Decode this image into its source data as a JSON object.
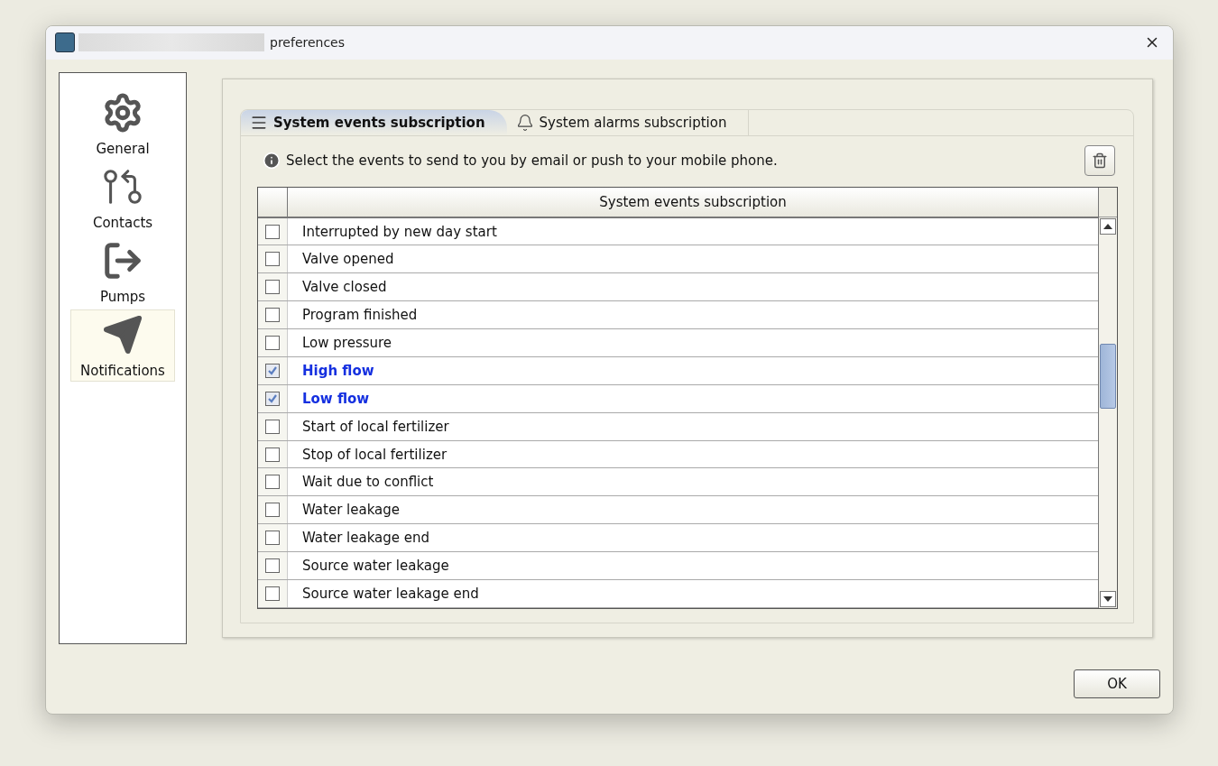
{
  "window": {
    "title": "preferences"
  },
  "sidebar": {
    "items": [
      {
        "label": "General",
        "selected": false
      },
      {
        "label": "Contacts",
        "selected": false
      },
      {
        "label": "Pumps",
        "selected": false
      },
      {
        "label": "Notifications",
        "selected": true
      }
    ]
  },
  "tabs": [
    {
      "label": "System events subscription",
      "selected": true
    },
    {
      "label": "System alarms subscription",
      "selected": false
    }
  ],
  "info": "Select the events to send to you by email or push to your mobile phone.",
  "table": {
    "columns": [
      "System events subscription"
    ],
    "rows": [
      {
        "label": "Interrupted by new day start",
        "checked": false
      },
      {
        "label": "Valve opened",
        "checked": false
      },
      {
        "label": "Valve closed",
        "checked": false
      },
      {
        "label": "Program finished",
        "checked": false
      },
      {
        "label": "Low pressure",
        "checked": false
      },
      {
        "label": "High flow",
        "checked": true
      },
      {
        "label": "Low flow",
        "checked": true
      },
      {
        "label": "Start of local fertilizer",
        "checked": false
      },
      {
        "label": "Stop of local fertilizer",
        "checked": false
      },
      {
        "label": "Wait due to conflict",
        "checked": false
      },
      {
        "label": "Water leakage",
        "checked": false
      },
      {
        "label": "Water leakage end",
        "checked": false
      },
      {
        "label": "Source water leakage",
        "checked": false
      },
      {
        "label": "Source water leakage end",
        "checked": false
      }
    ]
  },
  "buttons": [
    "OK"
  ]
}
